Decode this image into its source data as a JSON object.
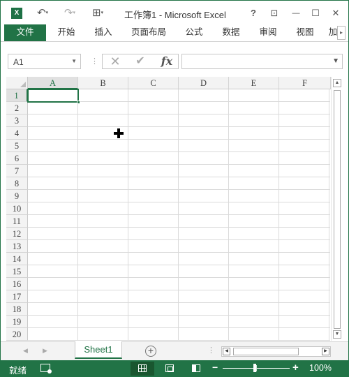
{
  "window": {
    "title": "工作簿1 - Microsoft Excel",
    "logo": "X",
    "controls": {
      "help": "?",
      "ribbon_display": "⊡",
      "minimize": "—",
      "maximize": "☐",
      "close": "✕"
    }
  },
  "quick_access": {
    "undo": "↶",
    "redo": "↷",
    "customize": "⊞"
  },
  "ribbon": {
    "tabs": [
      "文件",
      "开始",
      "插入",
      "页面布局",
      "公式",
      "数据",
      "审阅",
      "视图",
      "加"
    ],
    "scroll": "▸"
  },
  "formula_bar": {
    "name_box": "A1",
    "cancel": "✕",
    "enter": "✔",
    "function": "fx",
    "value": ""
  },
  "grid": {
    "columns": [
      "A",
      "B",
      "C",
      "D",
      "E",
      "F"
    ],
    "rows": [
      "1",
      "2",
      "3",
      "4",
      "5",
      "6",
      "7",
      "8",
      "9",
      "10",
      "11",
      "12",
      "13",
      "14",
      "15",
      "16",
      "17",
      "18",
      "19",
      "20"
    ],
    "selected_cell": "A1"
  },
  "sheets": {
    "tabs": [
      "Sheet1"
    ],
    "active": "Sheet1",
    "add": "+",
    "prev": "◀",
    "next": "▶"
  },
  "status_bar": {
    "mode": "就绪",
    "zoom": "100%",
    "zoom_out": "−",
    "zoom_in": "+"
  },
  "colors": {
    "accent": "#217346",
    "status_dark": "#19562f"
  }
}
